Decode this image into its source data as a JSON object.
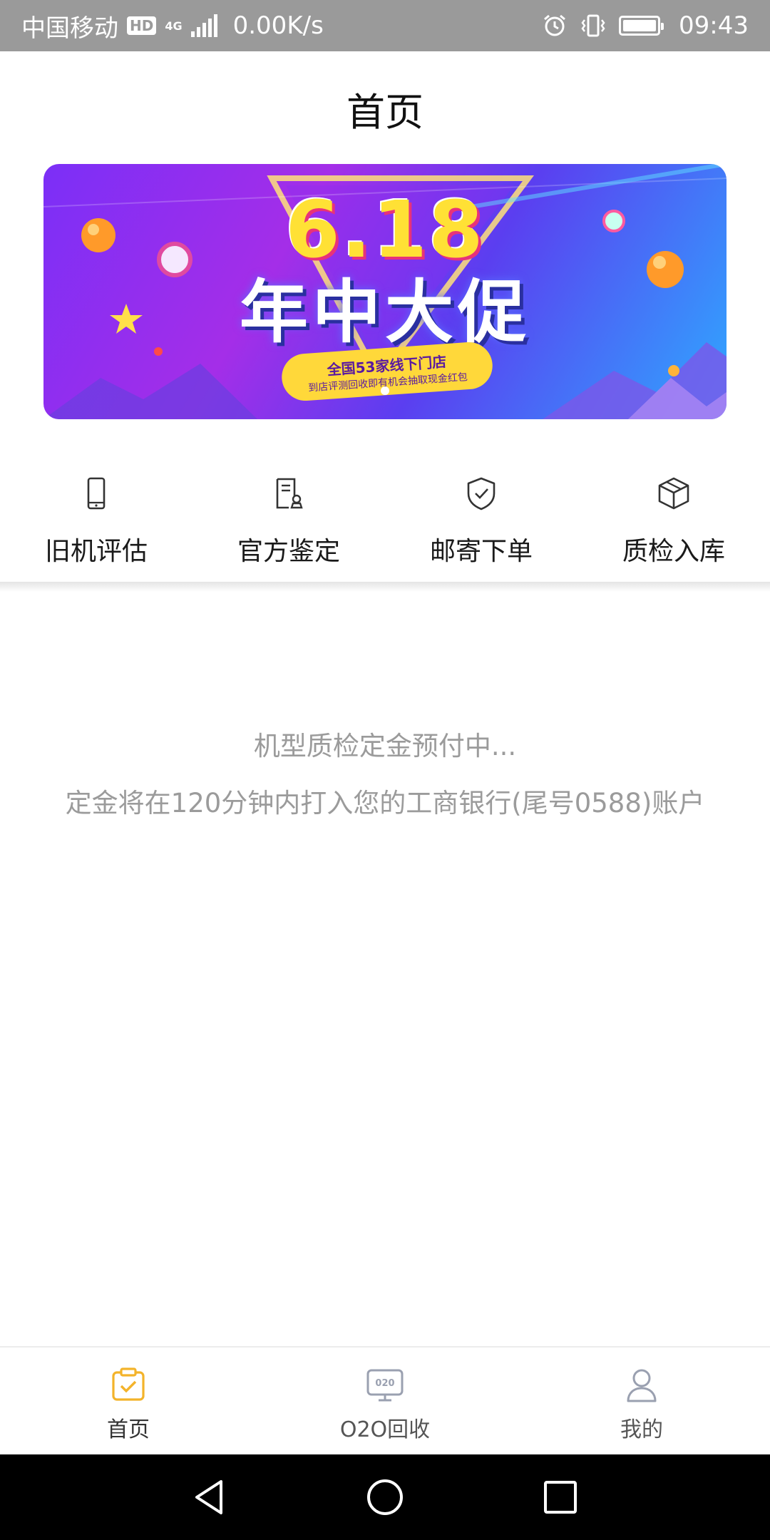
{
  "status_bar": {
    "carrier": "中国移动",
    "hd": "HD",
    "network": "4G",
    "speed": "0.00K/s",
    "time": "09:43"
  },
  "header": {
    "title": "首页"
  },
  "banner": {
    "headline": "6.18",
    "subheadline": "年中大促",
    "pill_line1": "全国53家线下门店",
    "pill_line2": "到店评测回收即有机会抽取现金红包"
  },
  "quick_actions": [
    {
      "label": "旧机评估",
      "icon": "phone-icon"
    },
    {
      "label": "官方鉴定",
      "icon": "certificate-icon"
    },
    {
      "label": "邮寄下单",
      "icon": "shield-check-icon"
    },
    {
      "label": "质检入库",
      "icon": "box-icon"
    }
  ],
  "message": {
    "line1": "机型质检定金预付中...",
    "line2": "定金将在120分钟内打入您的工商银行(尾号0588)账户"
  },
  "tabbar": {
    "items": [
      {
        "label": "首页",
        "icon": "clipboard-check-icon",
        "active": true
      },
      {
        "label": "O2O回收",
        "icon": "o2o-monitor-icon",
        "active": false
      },
      {
        "label": "我的",
        "icon": "person-icon",
        "active": false
      }
    ]
  },
  "colors": {
    "status_bar": "#9a9a9a",
    "accent": "#f3b32a",
    "inactive_icon": "#9aa0b0",
    "message_text": "#9b9b9b"
  }
}
